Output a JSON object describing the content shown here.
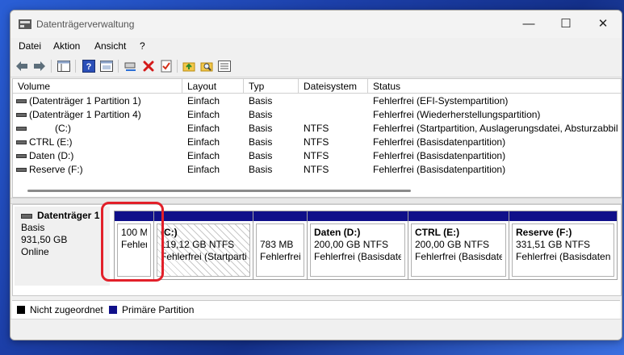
{
  "window": {
    "title": "Datenträgerverwaltung"
  },
  "menu": [
    "Datei",
    "Aktion",
    "Ansicht",
    "?"
  ],
  "toolbar_icons": [
    "back-icon",
    "forward-icon",
    "console-tree-icon",
    "help-icon",
    "properties-icon",
    "connect-icon",
    "delete-icon",
    "check-icon",
    "folder-up-icon",
    "search-folder-icon",
    "list-view-icon"
  ],
  "table": {
    "columns": [
      "Volume",
      "Layout",
      "Typ",
      "Dateisystem",
      "Status"
    ],
    "rows": [
      {
        "volume": "(Datenträger 1 Partition 1)",
        "layout": "Einfach",
        "type": "Basis",
        "fs": "",
        "status": "Fehlerfrei (EFI-Systempartition)"
      },
      {
        "volume": "(Datenträger 1 Partition 4)",
        "layout": "Einfach",
        "type": "Basis",
        "fs": "",
        "status": "Fehlerfrei (Wiederherstellungspartition)"
      },
      {
        "volume": "(C:)",
        "layout": "Einfach",
        "type": "Basis",
        "fs": "NTFS",
        "status": "Fehlerfrei (Startpartition, Auslagerungsdatei, Absturzabbil"
      },
      {
        "volume": "CTRL (E:)",
        "layout": "Einfach",
        "type": "Basis",
        "fs": "NTFS",
        "status": "Fehlerfrei (Basisdatenpartition)"
      },
      {
        "volume": "Daten (D:)",
        "layout": "Einfach",
        "type": "Basis",
        "fs": "NTFS",
        "status": "Fehlerfrei (Basisdatenpartition)"
      },
      {
        "volume": "Reserve (F:)",
        "layout": "Einfach",
        "type": "Basis",
        "fs": "NTFS",
        "status": "Fehlerfrei (Basisdatenpartition)"
      }
    ]
  },
  "disk": {
    "name": "Datenträger 1",
    "kind": "Basis",
    "size": "931,50 GB",
    "state": "Online",
    "partitions": [
      {
        "name": "",
        "line1": "100 M",
        "line2": "Fehler"
      },
      {
        "name": "(C:)",
        "line1": "119,12 GB NTFS",
        "line2": "Fehlerfrei (Startpartit"
      },
      {
        "name": "",
        "line1": "783 MB",
        "line2": "Fehlerfrei"
      },
      {
        "name": "Daten  (D:)",
        "line1": "200,00 GB NTFS",
        "line2": "Fehlerfrei (Basisdater"
      },
      {
        "name": "CTRL  (E:)",
        "line1": "200,00 GB NTFS",
        "line2": "Fehlerfrei (Basisdater"
      },
      {
        "name": "Reserve  (F:)",
        "line1": "331,51 GB NTFS",
        "line2": "Fehlerfrei (Basisdatenp"
      }
    ]
  },
  "legend": [
    {
      "label": "Nicht zugeordnet",
      "color": "#000000"
    },
    {
      "label": "Primäre Partition",
      "color": "#10108a"
    }
  ],
  "colors": {
    "primary_partition": "#10108a",
    "highlight": "#e2202a"
  }
}
